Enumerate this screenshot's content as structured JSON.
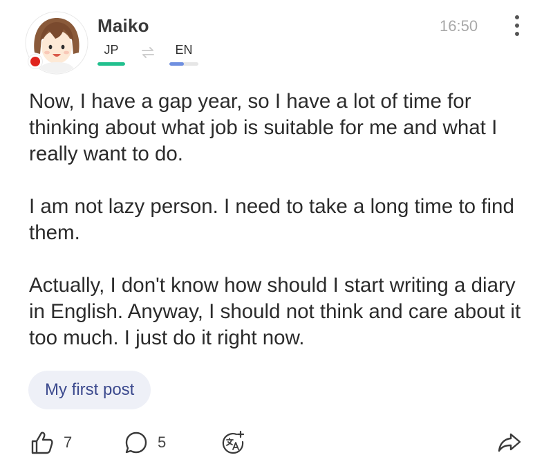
{
  "header": {
    "username": "Maiko",
    "timestamp": "16:50",
    "native_language": {
      "code": "JP",
      "level": 1.0,
      "color": "#21c08e"
    },
    "learning_language": {
      "code": "EN",
      "level": 0.5,
      "color": "#6f8fe0"
    },
    "status_color": "#e0231d"
  },
  "post": {
    "paragraphs": [
      "Now, I have a gap year, so I have a lot of time for thinking about what job is suitable for me and what I really want to do.",
      "I am not lazy person. I need to take a long time to find them.",
      "Actually, I don't know how should I start writing a diary in English. Anyway, I should not think and care about it too much. I just do it right now."
    ],
    "tag": "My first post"
  },
  "actions": {
    "likes": "7",
    "comments": "5"
  }
}
